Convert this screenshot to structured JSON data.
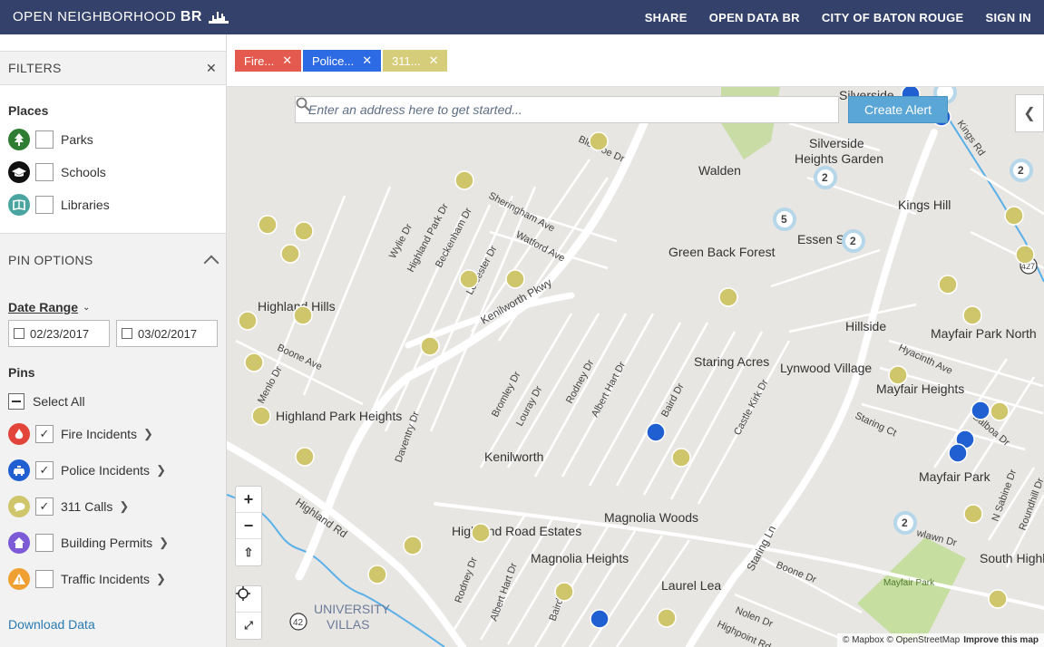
{
  "header": {
    "brand_main": "OPEN NEIGHBORHOOD",
    "brand_suffix": "BR",
    "nav": [
      "SHARE",
      "OPEN DATA BR",
      "CITY OF BATON ROUGE",
      "SIGN IN"
    ]
  },
  "sidebar": {
    "filters_title": "FILTERS",
    "places_title": "Places",
    "places": [
      {
        "label": "Parks",
        "icon": "tree-icon",
        "color": "#2e7d32"
      },
      {
        "label": "Schools",
        "icon": "graduation-cap-icon",
        "color": "#111111"
      },
      {
        "label": "Libraries",
        "icon": "book-icon",
        "color": "#4aa5a0"
      }
    ],
    "pin_options_title": "PIN OPTIONS",
    "date_range_label": "Date Range",
    "date_start": "02/23/2017",
    "date_end": "03/02/2017",
    "pins_title": "Pins",
    "select_all": "Select All",
    "pins": [
      {
        "label": "Fire Incidents",
        "icon": "flame-icon",
        "color": "#e2453a",
        "checked": true
      },
      {
        "label": "Police Incidents",
        "icon": "police-car-icon",
        "color": "#1f5fd1",
        "checked": true
      },
      {
        "label": "311 Calls",
        "icon": "speech-bubble-icon",
        "color": "#cfc56a",
        "checked": true
      },
      {
        "label": "Building Permits",
        "icon": "house-icon",
        "color": "#7d5ad6",
        "checked": false
      },
      {
        "label": "Traffic Incidents",
        "icon": "warning-icon",
        "color": "#f0a033",
        "checked": false
      }
    ],
    "download_label": "Download Data"
  },
  "tags": [
    {
      "label": "Fire...",
      "color": "#e55a4e"
    },
    {
      "label": "Police...",
      "color": "#2d6be4"
    },
    {
      "label": "311...",
      "color": "#d6cd7a"
    }
  ],
  "map": {
    "search_placeholder": "Enter an address here to get started...",
    "create_alert": "Create Alert",
    "attribution_1": "© Mapbox © OpenStreetMap",
    "attribution_2": "Improve this map",
    "neighborhoods": [
      "Silverside",
      "Silverside",
      "Heights Garden",
      "Walden",
      "Kings Hill",
      "Essen S",
      "Green Back Forest",
      "Highland Hills",
      "Hillside",
      "Mayfair Park North",
      "Staring Acres",
      "Lynwood Village",
      "Mayfair Heights",
      "Highland Park Heights",
      "Kenilworth",
      "Mayfair Park",
      "Magnolia Woods",
      "Highland Road Estates",
      "Magnolia Heights",
      "South Highl",
      "Laurel Lea",
      "UNIVERSITY",
      "VILLAS",
      "Mayfair Park"
    ],
    "streets": [
      "Bledsoe Dr",
      "Sheringham Ave",
      "Watford Ave",
      "Wylie Dr",
      "Highland Park Dr",
      "Beckenham Dr",
      "Leicester Dr",
      "Kenilworth Pkwy",
      "Boone Ave",
      "Menlo Dr",
      "Bromley Dr",
      "Louray Dr",
      "Rodney Dr",
      "Albert Hart Dr",
      "Baird Dr",
      "Castle Kirk Dr",
      "Hyacinth Ave",
      "Staring Ct",
      "Daventry Dr",
      "Highland Rd",
      "Staring Ln",
      "Boone Dr",
      "Nolen Dr",
      "Highpoint Rd",
      "Rodney Dr",
      "Albert Hart Dr",
      "Baird Dr",
      "Balboa Dr",
      "N Sabine Dr",
      "Roundhill Dr",
      "Kings Rd",
      "wlawn Dr",
      "42",
      "427"
    ],
    "clusters": [
      "2",
      "2",
      "2",
      "5",
      "2",
      "2"
    ]
  }
}
